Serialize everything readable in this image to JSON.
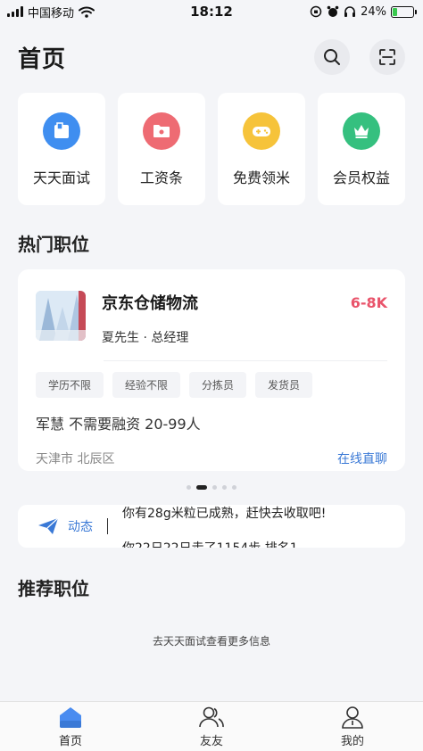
{
  "status_bar": {
    "carrier": "中国移动",
    "time": "18:12",
    "battery_percent": "24%",
    "battery_level": 0.24,
    "icons": [
      "signal-icon",
      "wifi-icon",
      "orientation-lock-icon",
      "alarm-icon",
      "headphones-icon",
      "battery-icon"
    ]
  },
  "header": {
    "title": "首页",
    "actions": [
      "search-icon",
      "scan-icon"
    ]
  },
  "quick_entries": [
    {
      "label": "天天面试",
      "icon": "interview-icon",
      "color": "#3f8ef0"
    },
    {
      "label": "工资条",
      "icon": "payslip-folder-icon",
      "color": "#ee6b73"
    },
    {
      "label": "免费领米",
      "icon": "gamepad-icon",
      "color": "#f6c33a"
    },
    {
      "label": "会员权益",
      "icon": "crown-icon",
      "color": "#35c07f"
    }
  ],
  "hot_jobs": {
    "section_title": "热门职位",
    "job": {
      "title": "京东仓储物流",
      "salary": "6-8K",
      "contact": "夏先生 · 总经理",
      "tags": [
        "学历不限",
        "经验不限",
        "分拣员",
        "发货员"
      ],
      "company_line": "军慧 不需要融资 20-99人",
      "location": "天津市 北辰区",
      "chat_label": "在线直聊"
    },
    "carousel_index": 1,
    "carousel_count": 5
  },
  "feed": {
    "label": "动态",
    "lines": [
      "你有28g米粒已成熟，赶快去收取吧!",
      "你22日22日走了1154步 排名1"
    ]
  },
  "recommend": {
    "section_title": "推荐职位",
    "more_info": "去天天面试查看更多信息"
  },
  "tab_bar": {
    "items": [
      {
        "label": "首页",
        "icon": "home-icon",
        "active": true
      },
      {
        "label": "友友",
        "icon": "friends-icon",
        "active": false
      },
      {
        "label": "我的",
        "icon": "profile-icon",
        "active": false
      }
    ]
  },
  "colors": {
    "accent_blue": "#3a79d6",
    "salary_red": "#e9546b",
    "page_bg": "#f4f5f8"
  }
}
